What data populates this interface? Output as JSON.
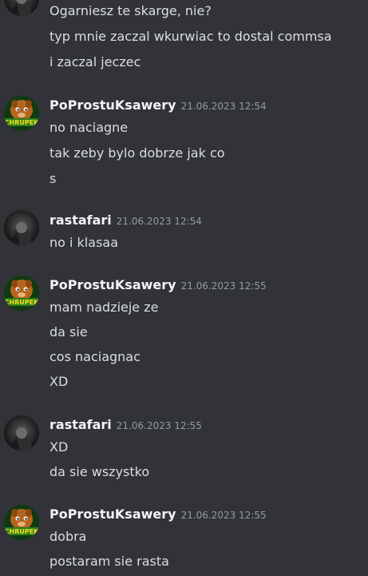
{
  "colors": {
    "background": "#313338",
    "username": "#f2f3f5",
    "message_text": "#dbdee1",
    "timestamp": "#949ba4"
  },
  "messages": [
    {
      "author": "",
      "timestamp": "",
      "avatar": "rastafari-avatar",
      "lines": [
        "Ogarniesz te skarge, nie?",
        "typ mnie zaczal wkurwiac to dostal commsa",
        "i zaczal jeczec"
      ]
    },
    {
      "author": "PoProstuKsawery",
      "timestamp": "21.06.2023 12:54",
      "avatar": "chrupek-avatar",
      "avatar_text": "CHRUPEK",
      "lines": [
        "no naciagne",
        "tak zeby bylo dobrze jak co",
        "s"
      ]
    },
    {
      "author": "rastafari",
      "timestamp": "21.06.2023 12:54",
      "avatar": "rastafari-avatar",
      "lines": [
        "no i klasaa"
      ]
    },
    {
      "author": "PoProstuKsawery",
      "timestamp": "21.06.2023 12:55",
      "avatar": "chrupek-avatar",
      "avatar_text": "CHRUPEK",
      "lines": [
        "mam nadzieje ze",
        "da sie",
        "cos naciagnac",
        "XD"
      ]
    },
    {
      "author": "rastafari",
      "timestamp": "21.06.2023 12:55",
      "avatar": "rastafari-avatar",
      "lines": [
        "XD",
        "da sie wszystko"
      ]
    },
    {
      "author": "PoProstuKsawery",
      "timestamp": "21.06.2023 12:55",
      "avatar": "chrupek-avatar",
      "avatar_text": "CHRUPEK",
      "lines": [
        "dobra",
        "postaram sie rasta"
      ]
    }
  ]
}
